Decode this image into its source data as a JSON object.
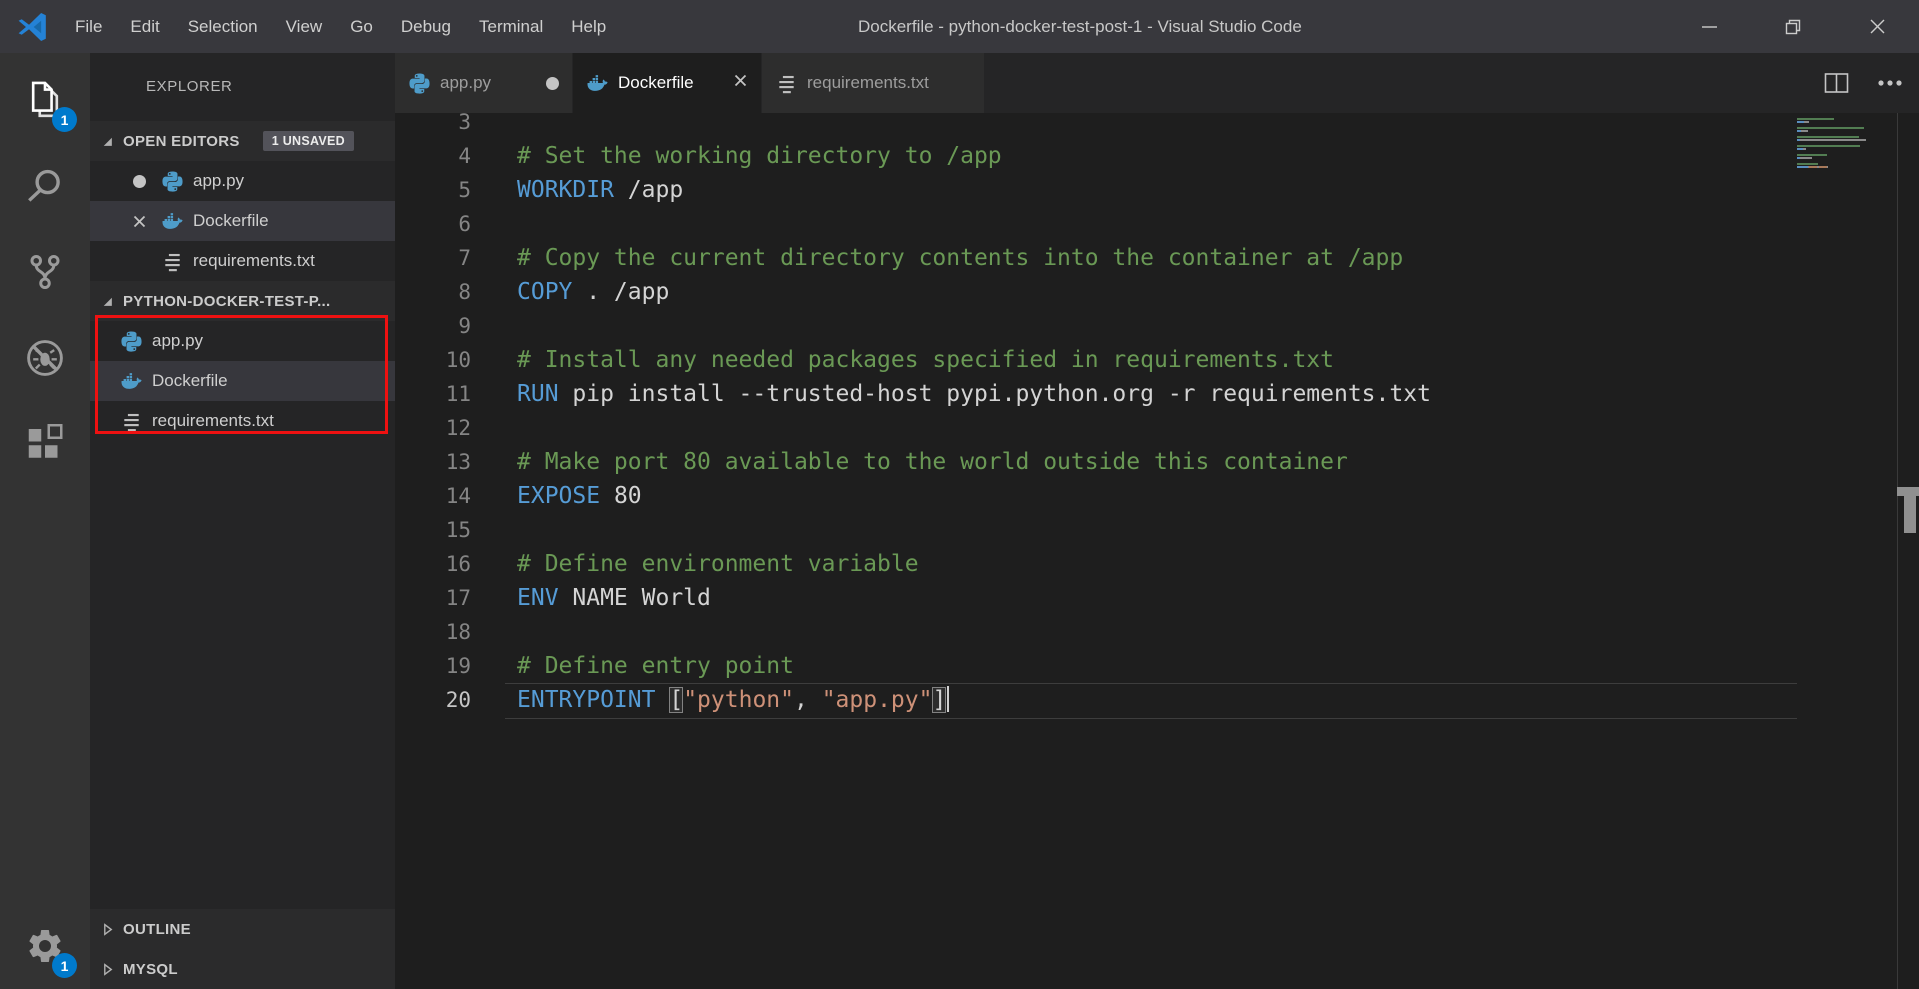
{
  "titlebar": {
    "menus": [
      "File",
      "Edit",
      "Selection",
      "View",
      "Go",
      "Debug",
      "Terminal",
      "Help"
    ],
    "title": "Dockerfile - python-docker-test-post-1 - Visual Studio Code",
    "controls": [
      "minimize",
      "restore",
      "close"
    ]
  },
  "activity_bar": {
    "badge_color": "#007acc",
    "explorer_badge": "1",
    "settings_badge": "1",
    "items": [
      "explorer",
      "search",
      "source-control",
      "debug",
      "extensions",
      "settings"
    ]
  },
  "sidebar": {
    "title": "EXPLORER",
    "open_editors": {
      "label": "OPEN EDITORS",
      "badge": "1 UNSAVED",
      "items": [
        {
          "label": "app.py",
          "icon": "python",
          "dirty": true,
          "selected": false
        },
        {
          "label": "Dockerfile",
          "icon": "docker",
          "closable": true,
          "selected": true
        },
        {
          "label": "requirements.txt",
          "icon": "text",
          "selected": false
        }
      ]
    },
    "folder": {
      "label": "PYTHON-DOCKER-TEST-P...",
      "items": [
        {
          "label": "app.py",
          "icon": "python",
          "selected": false
        },
        {
          "label": "Dockerfile",
          "icon": "docker",
          "selected": true
        },
        {
          "label": "requirements.txt",
          "icon": "text",
          "selected": false
        }
      ],
      "highlight_box_color": "#ee1111"
    },
    "bottom_sections": [
      {
        "label": "OUTLINE"
      },
      {
        "label": "MYSQL"
      }
    ]
  },
  "tabs": [
    {
      "label": "app.py",
      "icon": "python",
      "dirty": true,
      "active": false
    },
    {
      "label": "Dockerfile",
      "icon": "docker",
      "closable": true,
      "active": true
    },
    {
      "label": "requirements.txt",
      "icon": "text",
      "active": false
    }
  ],
  "editor_actions": {
    "split": "split-editor",
    "more": "more-actions"
  },
  "editor": {
    "language": "dockerfile",
    "colors": {
      "background": "#1e1e1e",
      "comment": "#6a9955",
      "keyword": "#569cd6",
      "string": "#ce9178",
      "plain": "#d4d4d4",
      "line_number": "#858585",
      "active_line_number": "#c6c6c6"
    },
    "first_visible_line": 3,
    "lines": [
      {
        "num": 3,
        "tokens": []
      },
      {
        "num": 4,
        "tokens": [
          {
            "t": "# Set the working directory to /app",
            "c": "comment"
          }
        ]
      },
      {
        "num": 5,
        "tokens": [
          {
            "t": "WORKDIR",
            "c": "keyword"
          },
          {
            "t": " /app",
            "c": "plain"
          }
        ]
      },
      {
        "num": 6,
        "tokens": []
      },
      {
        "num": 7,
        "tokens": [
          {
            "t": "# Copy the current directory contents into the container at /app",
            "c": "comment"
          }
        ]
      },
      {
        "num": 8,
        "tokens": [
          {
            "t": "COPY",
            "c": "keyword"
          },
          {
            "t": " . /app",
            "c": "plain"
          }
        ]
      },
      {
        "num": 9,
        "tokens": []
      },
      {
        "num": 10,
        "tokens": [
          {
            "t": "# Install any needed packages specified in requirements.txt",
            "c": "comment"
          }
        ]
      },
      {
        "num": 11,
        "tokens": [
          {
            "t": "RUN",
            "c": "keyword"
          },
          {
            "t": " pip install --trusted-host pypi.python.org -r requirements.txt",
            "c": "plain"
          }
        ]
      },
      {
        "num": 12,
        "tokens": []
      },
      {
        "num": 13,
        "tokens": [
          {
            "t": "# Make port 80 available to the world outside this container",
            "c": "comment"
          }
        ]
      },
      {
        "num": 14,
        "tokens": [
          {
            "t": "EXPOSE",
            "c": "keyword"
          },
          {
            "t": " 80",
            "c": "plain"
          }
        ]
      },
      {
        "num": 15,
        "tokens": []
      },
      {
        "num": 16,
        "tokens": [
          {
            "t": "# Define environment variable",
            "c": "comment"
          }
        ]
      },
      {
        "num": 17,
        "tokens": [
          {
            "t": "ENV",
            "c": "keyword"
          },
          {
            "t": " NAME World",
            "c": "plain"
          }
        ]
      },
      {
        "num": 18,
        "tokens": []
      },
      {
        "num": 19,
        "tokens": [
          {
            "t": "# Define entry point",
            "c": "comment"
          }
        ]
      },
      {
        "num": 20,
        "current": true,
        "tokens": [
          {
            "t": "ENTRYPOINT",
            "c": "keyword"
          },
          {
            "t": " ",
            "c": "plain"
          },
          {
            "t": "[",
            "c": "plain",
            "bracket": true
          },
          {
            "t": "\"python\"",
            "c": "string"
          },
          {
            "t": ", ",
            "c": "plain"
          },
          {
            "t": "\"app.py\"",
            "c": "string"
          },
          {
            "t": "]",
            "c": "plain",
            "bracket": true,
            "cursor_after": true
          }
        ]
      }
    ]
  }
}
